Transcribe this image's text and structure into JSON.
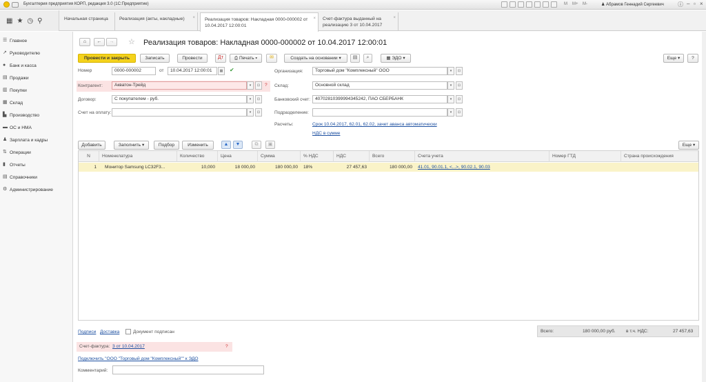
{
  "app": {
    "title": "Бухгалтерия предприятия КОРП, редакция 3.0  (1С:Предприятие)",
    "user": "Абрамов Геннадий Сергеевич",
    "title_marks": [
      "M",
      "M+",
      "M-"
    ]
  },
  "tabs": [
    {
      "label": "Начальная страница"
    },
    {
      "label": "Реализация (акты, накладные)"
    },
    {
      "label": "Реализация товаров: Накладная 0000-000002 от 10.04.2017 12:00:01"
    },
    {
      "label": "Счет-фактура выданный на реализацию 3 от 10.04.2017"
    }
  ],
  "sidebar": {
    "items": [
      {
        "label": "Главное",
        "icon": "list-icon"
      },
      {
        "label": "Руководителю",
        "icon": "chart-line-icon"
      },
      {
        "label": "Банк и касса",
        "icon": "coins-icon"
      },
      {
        "label": "Продажи",
        "icon": "cart-icon"
      },
      {
        "label": "Покупки",
        "icon": "basket-icon"
      },
      {
        "label": "Склад",
        "icon": "warehouse-icon"
      },
      {
        "label": "Производство",
        "icon": "factory-icon"
      },
      {
        "label": "ОС и НМА",
        "icon": "truck-icon"
      },
      {
        "label": "Зарплата и кадры",
        "icon": "people-icon"
      },
      {
        "label": "Операции",
        "icon": "operations-icon"
      },
      {
        "label": "Отчеты",
        "icon": "bar-chart-icon"
      },
      {
        "label": "Справочники",
        "icon": "book-icon"
      },
      {
        "label": "Администрирование",
        "icon": "gear-icon"
      }
    ]
  },
  "doc": {
    "title": "Реализация товаров: Накладная 0000-000002 от 10.04.2017 12:00:01"
  },
  "toolbar": {
    "post_close": "Провести и закрыть",
    "save": "Записать",
    "post": "Провести",
    "print": "Печать",
    "create_based": "Создать на основании",
    "edo": "ЭДО",
    "more": "Еще",
    "help": "?"
  },
  "form": {
    "number_label": "Номер",
    "number": "0000-000002",
    "date_label": "от",
    "date": "10.04.2017 12:00:01",
    "org_label": "Организация:",
    "org": "Торговый дом \"Комплексный\" ООО",
    "contractor_label": "Контрагент:",
    "contractor": "Акватон-Трейд",
    "warehouse_label": "Склад:",
    "warehouse": "Основной склад",
    "contract_label": "Договор:",
    "contract": "С покупателем - руб.",
    "bank_label": "Банковский счет:",
    "bank": "40702810399994345242, ПАО СБЕРБАНК",
    "invoice_pay_label": "Счет на оплату:",
    "invoice_pay": "",
    "division_label": "Подразделение:",
    "division": "",
    "settlements_label": "Расчеты:",
    "settlements": "Срок 10.04.2017, 62.01, 62.02, зачет аванса автоматически",
    "vat_link": "НДС в сумме"
  },
  "table_toolbar": {
    "add": "Добавить",
    "fill": "Заполнить",
    "pick": "Подбор",
    "change": "Изменить",
    "more": "Еще"
  },
  "table": {
    "columns": [
      "N",
      "Номенклатура",
      "Количество",
      "Цена",
      "Сумма",
      "% НДС",
      "НДС",
      "Всего",
      "Счета учета",
      "Номер ГТД",
      "Страна происхождения"
    ],
    "rows": [
      [
        "1",
        "Монитор Samsung LC32F3...",
        "10,000",
        "18 000,00",
        "180 000,00",
        "18%",
        "27 457,63",
        "180 000,00",
        "41.01, 90.01.1, <...>, 90.02.1, 90.03",
        "",
        ""
      ]
    ]
  },
  "footer": {
    "signatures": "Подписи",
    "delivery": "Доставка",
    "signed": "Документ подписан",
    "total_label": "Всего:",
    "total": "180 000,00",
    "currency": "руб.",
    "vat_incl_label": "в т.ч. НДС:",
    "vat_incl": "27 457,63",
    "invoice_label": "Счет-фактура:",
    "invoice": "3 от 10.04.2017",
    "invoice_q": "?",
    "edo_link": "Подключить \"ООО \"Торговый дом \"Комплексный\"\" к ЭДО",
    "comment_label": "Комментарий:",
    "comment": ""
  }
}
